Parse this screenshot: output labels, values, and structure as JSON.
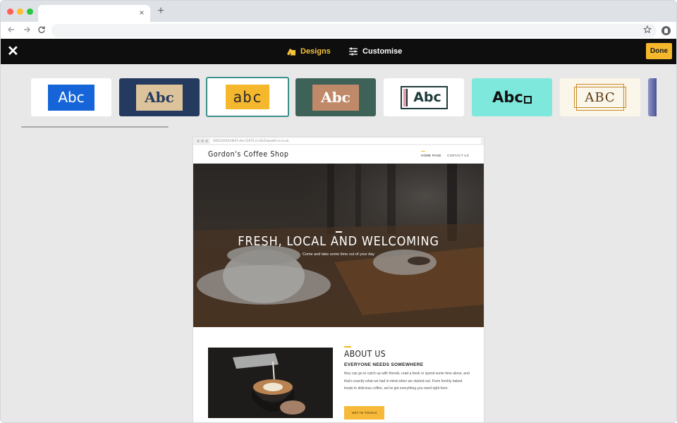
{
  "browser": {
    "tab_close": "×",
    "new_tab": "+",
    "back_icon": "arrow-left-icon",
    "forward_icon": "arrow-right-icon",
    "reload_icon": "reload-icon",
    "bookmark_icon": "star-icon",
    "profile_icon": "profile-icon"
  },
  "editor": {
    "close_label": "✕",
    "designs_label": "Designs",
    "customise_label": "Customise",
    "done_label": "Done",
    "accent_color": "#f5c23a"
  },
  "design_cards": [
    {
      "text": "Abc",
      "name": "design-card-1",
      "bg": "#ffffff",
      "tile": "#1565d8",
      "fg": "#ffffff"
    },
    {
      "text": "Abc",
      "name": "design-card-2",
      "bg": "#243a5e",
      "tile": "#dcc39b",
      "fg": "#243a5e"
    },
    {
      "text": "abc",
      "name": "design-card-3",
      "bg": "#ffffff",
      "tile": "#f5b72c",
      "fg": "#2b2b2b",
      "selected": true
    },
    {
      "text": "Abc",
      "name": "design-card-4",
      "bg": "#3e6258",
      "tile": "#c08a6a",
      "fg": "#ffffff"
    },
    {
      "text": "Abc",
      "name": "design-card-5",
      "bg": "#ffffff",
      "tile": "#ffffff",
      "fg": "#1f3b3b"
    },
    {
      "text": "Abc",
      "name": "design-card-6",
      "bg": "#7fe8dc",
      "tile": "#7fe8dc",
      "fg": "#111111"
    },
    {
      "text": "ABC",
      "name": "design-card-7",
      "bg": "#fbf6ea",
      "tile": "#fbf6ea",
      "fg": "#5a3a14"
    }
  ],
  "preview": {
    "url": "00012019124647-dev-11973.cl.site2.basekit-cs.co.uk",
    "logo": "Gordon's Coffee Shop",
    "nav": {
      "home": "HOME PAGE",
      "contact": "CONTACT US"
    },
    "hero": {
      "title": "FRESH, LOCAL AND WELCOMING",
      "subtitle": "Come and take some time out of your day"
    },
    "about": {
      "title": "ABOUT US",
      "subtitle": "EVERYONE NEEDS SOMEWHERE",
      "body": "they can go to catch up with friends, read a book or spend some time alone, and that's exactly what we had in mind when we started out. From freshly baked treats to delicious coffee, we've got everything you need right here.",
      "button": "GET IN TOUCH"
    }
  }
}
